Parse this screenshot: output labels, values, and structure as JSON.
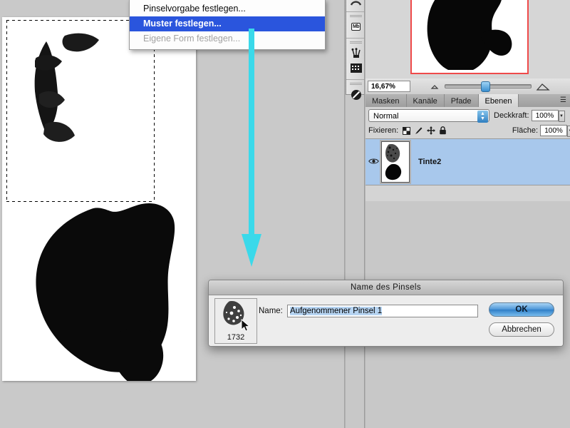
{
  "app": {
    "zoom_level": "16,67%"
  },
  "context_menu": {
    "items": [
      {
        "label": "Pinselvorgabe festlegen...",
        "state": "normal"
      },
      {
        "label": "Muster festlegen...",
        "state": "highlighted"
      },
      {
        "label": "Eigene Form festlegen...",
        "state": "disabled"
      }
    ]
  },
  "panels": {
    "tabs": [
      {
        "label": "Masken",
        "active": false
      },
      {
        "label": "Kanäle",
        "active": false
      },
      {
        "label": "Pfade",
        "active": false
      },
      {
        "label": "Ebenen",
        "active": true
      }
    ],
    "layers": {
      "blend_mode": "Normal",
      "opacity_label": "Deckkraft:",
      "opacity_value": "100%",
      "lock_label": "Fixieren:",
      "lock_icons": [
        "transparency-lock-icon",
        "paint-lock-icon",
        "move-lock-icon",
        "all-lock-icon"
      ],
      "fill_label": "Fläche:",
      "fill_value": "100%",
      "rows": [
        {
          "name": "Tinte2",
          "visible": true,
          "selected": true
        }
      ]
    }
  },
  "dock": {
    "buttons": [
      {
        "icon": "history-arc-icon",
        "label": ""
      },
      {
        "icon": "measurement-mb-icon",
        "label": "Mb"
      },
      {
        "icon": "tool-presets-icon",
        "label": ""
      },
      {
        "icon": "swatch-grid-icon",
        "label": ""
      },
      {
        "icon": "adjustments-circle-icon",
        "label": ""
      }
    ]
  },
  "dialog": {
    "title": "Name des Pinsels",
    "name_label": "Name:",
    "name_value": "Aufgenommener Pinsel 1",
    "brush_size": "1732",
    "ok_label": "OK",
    "cancel_label": "Abbrechen"
  },
  "annotation": {
    "arrow_color": "#3ad9ea"
  }
}
